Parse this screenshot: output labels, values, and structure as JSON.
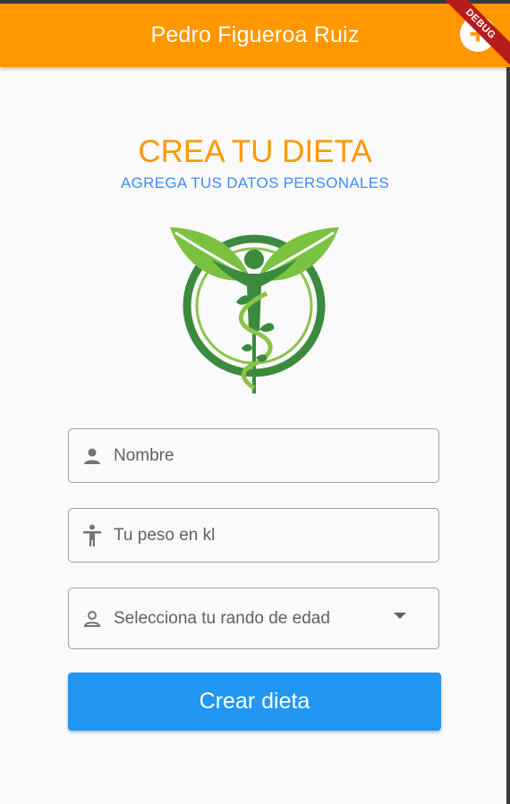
{
  "appbar": {
    "title": "Pedro Figueroa Ruiz",
    "debug_label": "DEBUG",
    "add_glyph": "+"
  },
  "header": {
    "title": "CREA TU DIETA",
    "subtitle": "AGREGA TUS DATOS PERSONALES"
  },
  "form": {
    "name": {
      "placeholder": "Nombre",
      "icon": "person-icon"
    },
    "weight": {
      "placeholder": "Tu peso en kl",
      "icon": "accessibility-icon"
    },
    "age": {
      "placeholder": "Selecciona  tu rando de edad",
      "icon": "person-outline-icon"
    },
    "submit_label": "Crear dieta"
  },
  "colors": {
    "appbar": "#ff9800",
    "title": "#ff9800",
    "subtitle": "#3d8bfd",
    "button": "#2196f3"
  }
}
